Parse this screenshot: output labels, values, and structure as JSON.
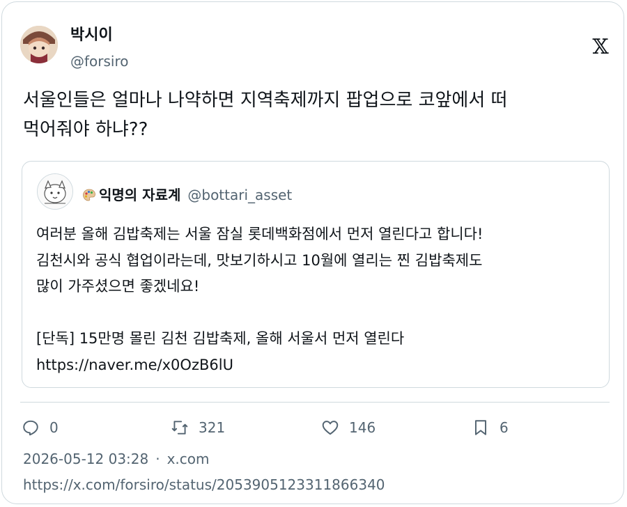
{
  "author": {
    "display_name": "박시이",
    "handle": "@forsiro"
  },
  "brand": {
    "logo_glyph": "𝕏",
    "icon": "x-logo-icon"
  },
  "tweet": {
    "text": "서울인들은 얼마나 나약하면 지역축제까지 팝업으로 코앞에서 떠\n먹어줘야 하냐??"
  },
  "quote": {
    "display_name": "익명의 자료계",
    "handle": "@bottari_asset",
    "name_icon": "palette-icon",
    "text": "여러분 올해 김밥축제는 서울 잠실 롯데백화점에서 먼저 열린다고 합니다!\n김천시와 공식 협업이라는데, 맛보기하시고 10월에 열리는 찐 김밥축제도\n많이 가주셨으면 좋겠네요!\n\n[단독] 15만명 몰린 김천 김밥축제, 올해 서울서 먼저 열린다\nhttps://naver.me/x0OzB6lU"
  },
  "actions": {
    "reply_count": "0",
    "repost_count": "321",
    "like_count": "146",
    "bookmark_count": "6"
  },
  "meta": {
    "timestamp": "2026-05-12 03:28",
    "separator": "·",
    "source": "x.com",
    "permalink": "https://x.com/forsiro/status/2053905123311866340"
  },
  "colors": {
    "text": "#0f1419",
    "secondary": "#536471",
    "border": "#cfd9de"
  }
}
